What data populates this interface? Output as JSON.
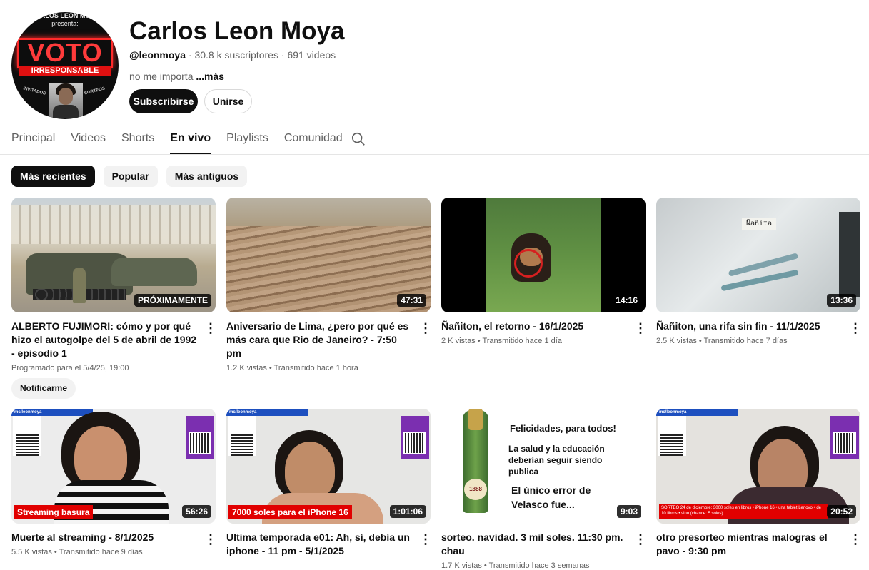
{
  "channel": {
    "name": "Carlos Leon Moya",
    "handle": "@leonmoya",
    "subscribers": "30.8 k suscriptores",
    "videos": "691 videos",
    "description": "no me importa",
    "more": "...más",
    "subscribe_label": "Subscribirse",
    "join_label": "Unirse",
    "avatar_text": {
      "top": "CARLOS LEÓN MOYA",
      "presenta": "presenta:",
      "voto": "VOTO",
      "irresponsable": "IRRESPONSABLE",
      "invitados": "INVITADOS",
      "sorteos": "SORTEOS"
    }
  },
  "tabs": [
    "Principal",
    "Videos",
    "Shorts",
    "En vivo",
    "Playlists",
    "Comunidad"
  ],
  "active_tab": "En vivo",
  "chips": [
    "Más recientes",
    "Popular",
    "Más antiguos"
  ],
  "videos": [
    {
      "title": "ALBERTO FUJIMORI: cómo y por qué hizo el autogolpe del 5 de abril de 1992 - episodio 1",
      "duration": "PRÓXIMAMENTE",
      "meta": "Programado para el 5/4/25, 19:00",
      "action": "Notificarme"
    },
    {
      "title": "Aniversario de Lima, ¿pero por qué es más cara que Rio de Janeiro? - 7:50 pm",
      "duration": "47:31",
      "meta": "1.2 K vistas • Transmitido hace 1 hora"
    },
    {
      "title": "Ñañiton, el retorno - 16/1/2025",
      "duration": "14:16",
      "meta": "2 K vistas • Transmitido hace 1 día"
    },
    {
      "title": "Ñañiton, una rifa sin fin - 11/1/2025",
      "duration": "13:36",
      "meta": "2.5 K vistas • Transmitido hace 7 días",
      "thumb_label": "Ñañita"
    },
    {
      "title": "Muerte al streaming - 8/1/2025",
      "duration": "56:26",
      "meta": "5.5 K vistas • Transmitido hace 9 días",
      "overlay": "Streaming basura"
    },
    {
      "title": "Ultima temporada e01: Ah, sí, debía un iphone - 11 pm - 5/1/2025",
      "duration": "1:01:06",
      "meta": "",
      "overlay": "7000 soles para el iPhone 16"
    },
    {
      "title": "sorteo. navidad. 3 mil soles. 11:30 pm. chau",
      "duration": "9:03",
      "meta": "1.7 K vistas • Transmitido hace 3 semanas",
      "thumb_lines": [
        "Felicidades, para todos!",
        "La salud y la educación deberían seguir siendo publica",
        "El único error de Velasco fue..."
      ],
      "bottle_label": "1888"
    },
    {
      "title": "otro presorteo mientras malogras el pavo - 9:30 pm",
      "duration": "20:52",
      "meta": "",
      "overlay": "SORTEO 24 de diciembre: 3000 soles en libros • iPhone 16 • una tablet Lenovo • de 10 libros • vino (chance: 5 soles)"
    }
  ],
  "stream_banner": "mc/leonmoya",
  "colors": {
    "accent": "#0f0f0f",
    "muted": "#606060",
    "live_red": "#e10000"
  }
}
